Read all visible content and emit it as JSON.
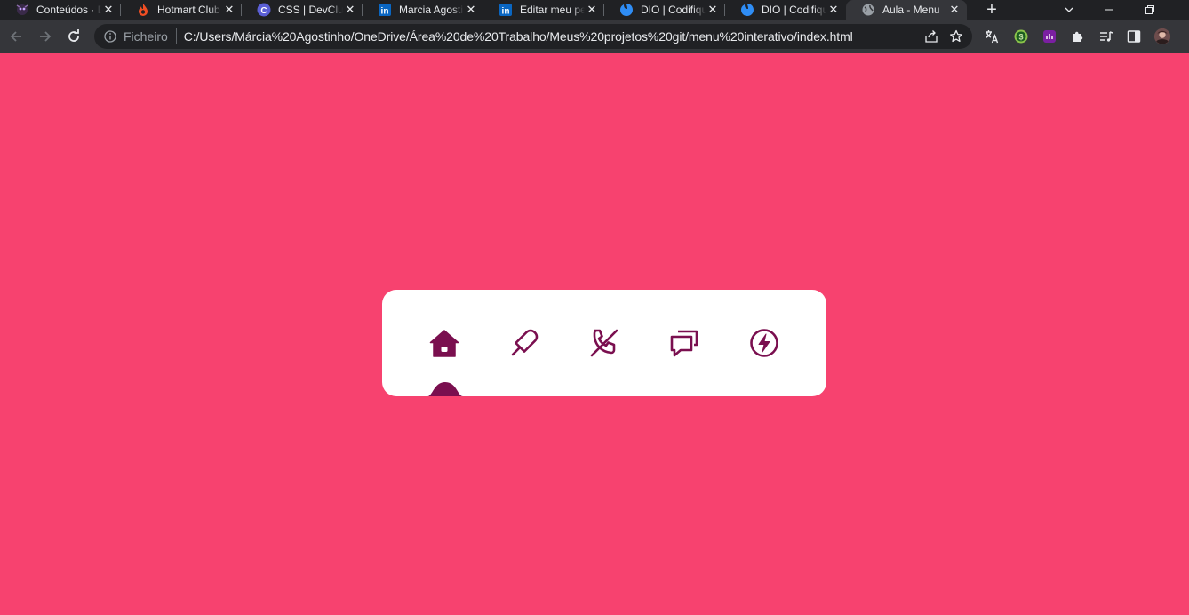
{
  "browser": {
    "tabs": [
      {
        "title": "Conteúdos · DIO",
        "favicon": "dio-skull-icon",
        "active": false
      },
      {
        "title": "Hotmart Club",
        "favicon": "hotmart-flame-icon",
        "active": false
      },
      {
        "title": "CSS | DevClub",
        "favicon": "devclub-c-icon",
        "active": false
      },
      {
        "title": "Marcia Agostinho",
        "favicon": "linkedin-icon",
        "active": false
      },
      {
        "title": "Editar meu perfil",
        "favicon": "linkedin-icon",
        "active": false
      },
      {
        "title": "DIO | Codifique",
        "favicon": "dio-drop-icon",
        "active": false
      },
      {
        "title": "DIO | Codifique",
        "favicon": "dio-drop-icon",
        "active": false
      },
      {
        "title": "Aula - Menu",
        "favicon": "globe-icon",
        "active": true
      }
    ],
    "address": {
      "scheme_label": "Ficheiro",
      "url": "C:/Users/Márcia%20Agostinho/OneDrive/Área%20de%20Trabalho/Meus%20projetos%20git/menu%20interativo/index.html"
    },
    "colors": {
      "tabstrip": "#202124",
      "toolbar": "#35363a",
      "omnibox": "#202124"
    }
  },
  "page": {
    "background": "#f7426f",
    "menu": {
      "card_color": "#ffffff",
      "icon_color": "#7a0f4f",
      "active_index": 0,
      "items": [
        {
          "icon": "home-icon",
          "active": true
        },
        {
          "icon": "popsicle-icon",
          "active": false
        },
        {
          "icon": "phone-off-icon",
          "active": false
        },
        {
          "icon": "chat-bubbles-icon",
          "active": false
        },
        {
          "icon": "bolt-circle-icon",
          "active": false
        }
      ]
    }
  }
}
